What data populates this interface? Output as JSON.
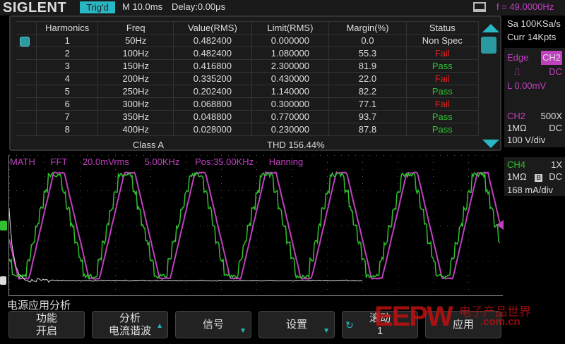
{
  "topbar": {
    "brand": "SIGLENT",
    "trigger_status": "Trig'd",
    "timebase": "M 10.0ms",
    "delay": "Delay:0.00μs",
    "frequency": "f = 49.0000Hz"
  },
  "table": {
    "headers": [
      "Harmonics",
      "Freq",
      "Value(RMS)",
      "Limit(RMS)",
      "Margin(%)",
      "Status"
    ],
    "rows": [
      [
        "1",
        "50Hz",
        "0.482400",
        "0.000000",
        "0.0",
        "Non Spec"
      ],
      [
        "2",
        "100Hz",
        "0.482400",
        "1.080000",
        "55.3",
        "Fail"
      ],
      [
        "3",
        "150Hz",
        "0.416800",
        "2.300000",
        "81.9",
        "Pass"
      ],
      [
        "4",
        "200Hz",
        "0.335200",
        "0.430000",
        "22.0",
        "Fail"
      ],
      [
        "5",
        "250Hz",
        "0.202400",
        "1.140000",
        "82.2",
        "Pass"
      ],
      [
        "6",
        "300Hz",
        "0.068800",
        "0.300000",
        "77.1",
        "Fail"
      ],
      [
        "7",
        "350Hz",
        "0.048800",
        "0.770000",
        "93.7",
        "Pass"
      ],
      [
        "8",
        "400Hz",
        "0.028000",
        "0.230000",
        "87.8",
        "Pass"
      ]
    ],
    "class": "Class A",
    "thd": "THD 156.44%"
  },
  "math": {
    "label": "MATH",
    "mode": "FFT",
    "scale": "20.0mVrms",
    "span": "5.00KHz",
    "pos": "Pos:35.00KHz",
    "window": "Hanning"
  },
  "side": {
    "sa": "Sa 100KSa/s",
    "curr": "Curr 14Kpts",
    "trigger": {
      "type": "Edge",
      "source": "CH2",
      "slope_icon": "rising-edge-icon",
      "coupling": "DC",
      "level": "L  0.00mV"
    },
    "ch2": {
      "name": "CH2",
      "probe": "500X",
      "impedance": "1MΩ",
      "coupling": "DC",
      "scale": "100 V/div"
    },
    "ch4": {
      "name": "CH4",
      "probe": "1X",
      "impedance": "1MΩ",
      "bw": "B",
      "coupling": "DC",
      "scale": "168 mA/div"
    }
  },
  "menu": {
    "title": "电源应用分析",
    "buttons": [
      {
        "l1": "功能",
        "l2": "开启"
      },
      {
        "l1": "分析",
        "l2": "电流谐波"
      },
      {
        "l1": "信号",
        "l2": ""
      },
      {
        "l1": "设置",
        "l2": ""
      },
      {
        "l1": "滚动",
        "l2": "1"
      },
      {
        "l1": "应用",
        "l2": ""
      }
    ]
  },
  "watermark": {
    "text": "EEPW",
    "cn": "电子产品世界",
    "url": ".com.cn"
  },
  "colors": {
    "ch2": "#c040c0",
    "ch4": "#30c030",
    "accent": "#2ab7c4",
    "fail": "#e02020",
    "pass": "#30c030"
  }
}
